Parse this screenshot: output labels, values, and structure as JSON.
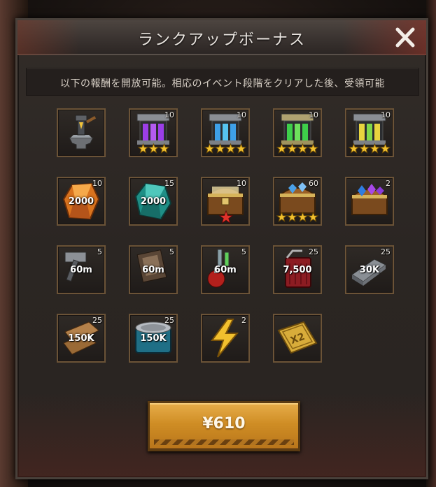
{
  "dialog": {
    "title": "ランクアップボーナス",
    "notice": "以下の報酬を開放可能。相応のイベント段階をクリアした後、受領可能",
    "buy_button": "¥610"
  },
  "rewards": [
    {
      "icon": "anvil-hammer-icon",
      "qty": "",
      "amount": "",
      "stars": 0
    },
    {
      "icon": "purple-serum-rack-icon",
      "qty": "10",
      "amount": "",
      "stars": 3
    },
    {
      "icon": "blue-serum-rack-icon",
      "qty": "10",
      "amount": "",
      "stars": 4
    },
    {
      "icon": "green-serum-rack-icon",
      "qty": "10",
      "amount": "",
      "stars": 4
    },
    {
      "icon": "yellow-serum-rack-icon",
      "qty": "10",
      "amount": "",
      "stars": 4
    },
    {
      "icon": "orange-crystal-icon",
      "qty": "10",
      "amount": "2000",
      "stars": 0
    },
    {
      "icon": "teal-crystal-icon",
      "qty": "15",
      "amount": "2000",
      "stars": 0
    },
    {
      "icon": "treasure-chest-red-star-icon",
      "qty": "10",
      "amount": "",
      "stars": 0
    },
    {
      "icon": "treasure-chest-blue-gems-icon",
      "qty": "60",
      "amount": "",
      "stars": 4
    },
    {
      "icon": "treasure-chest-purple-gems-icon",
      "qty": "2",
      "amount": "",
      "stars": 0
    },
    {
      "icon": "hammer-speedup-icon",
      "qty": "5",
      "amount": "60m",
      "stars": 0
    },
    {
      "icon": "book-speedup-icon",
      "qty": "5",
      "amount": "60m",
      "stars": 0
    },
    {
      "icon": "potion-speedup-icon",
      "qty": "5",
      "amount": "60m",
      "stars": 0
    },
    {
      "icon": "fuel-can-icon",
      "qty": "25",
      "amount": "7,500",
      "stars": 0
    },
    {
      "icon": "steel-beam-icon",
      "qty": "25",
      "amount": "30K",
      "stars": 0
    },
    {
      "icon": "wood-planks-icon",
      "qty": "25",
      "amount": "150K",
      "stars": 0
    },
    {
      "icon": "food-can-icon",
      "qty": "25",
      "amount": "150K",
      "stars": 0
    },
    {
      "icon": "lightning-energy-icon",
      "qty": "2",
      "amount": "",
      "stars": 0
    },
    {
      "icon": "gold-x2-ticket-icon",
      "qty": "",
      "amount": "",
      "stars": 0
    }
  ],
  "x2_text": "X2"
}
